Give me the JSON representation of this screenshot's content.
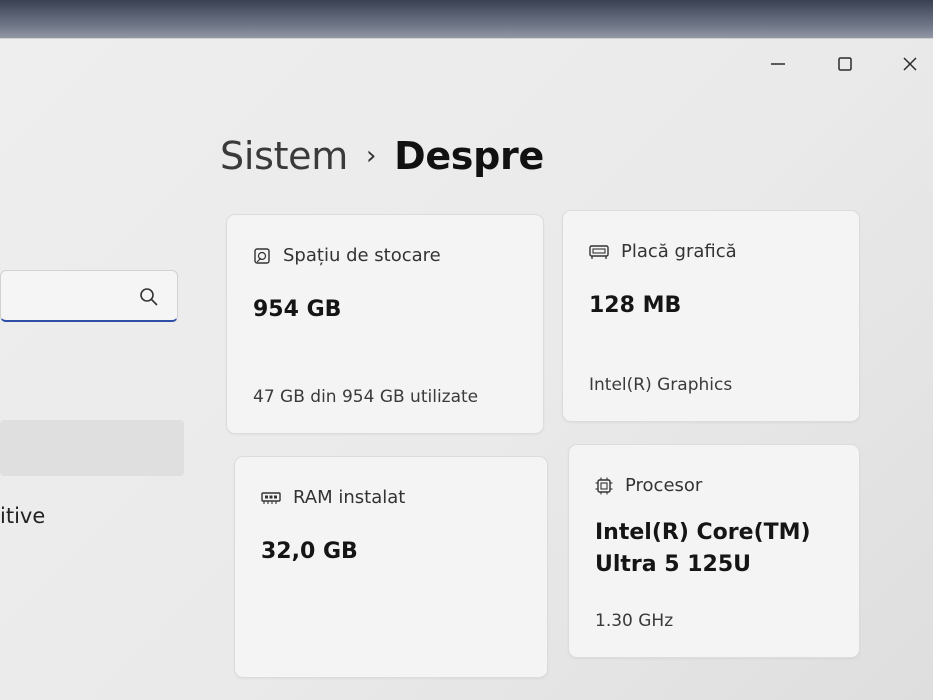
{
  "window": {
    "controls": [
      "minimize",
      "maximize",
      "close"
    ]
  },
  "breadcrumb": {
    "parent": "Sistem",
    "current": "Despre"
  },
  "sidebar": {
    "item_partial": "itive"
  },
  "cards": {
    "storage": {
      "icon": "storage-drive-icon",
      "title": "Spațiu de stocare",
      "value": "954 GB",
      "note": "47 GB din 954 GB utilizate"
    },
    "gpu": {
      "icon": "graphics-card-icon",
      "title": "Placă grafică",
      "value": "128 MB",
      "note": "Intel(R) Graphics"
    },
    "ram": {
      "icon": "memory-icon",
      "title": "RAM instalat",
      "value": "32,0 GB"
    },
    "cpu": {
      "icon": "processor-icon",
      "title": "Procesor",
      "value_line1": "Intel(R) Core(TM)",
      "value_line2": "Ultra 5 125U",
      "note": "1.30 GHz"
    }
  },
  "colors": {
    "accent": "#2f4fa7",
    "card_bg": "#f4f4f4",
    "window_bg": "#eeeeee"
  }
}
